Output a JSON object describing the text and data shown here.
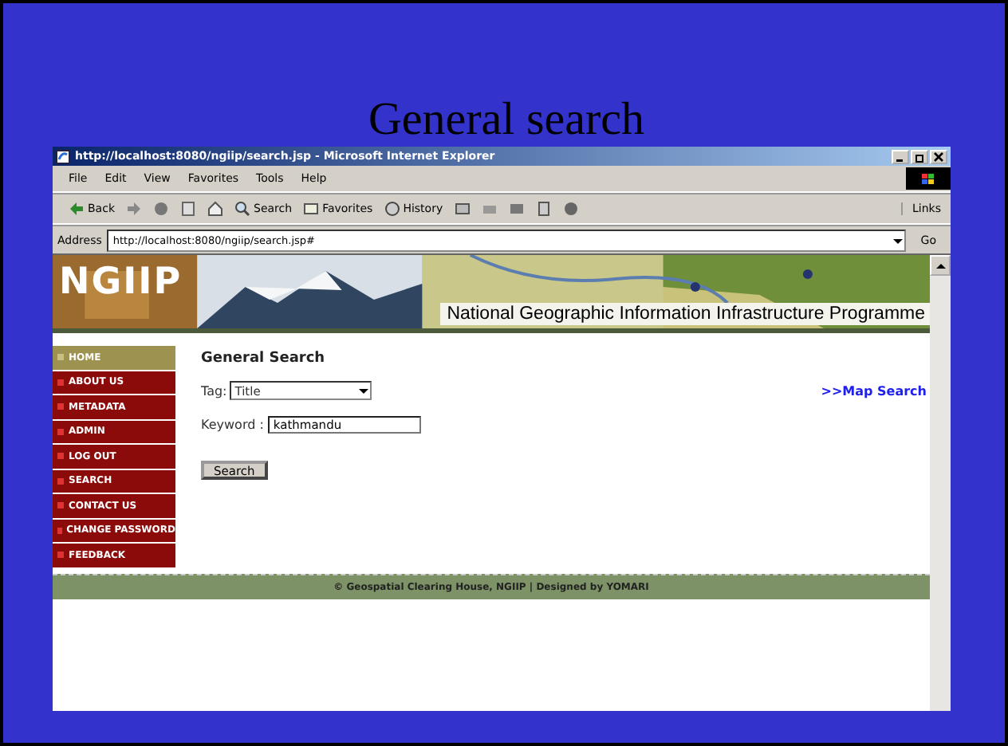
{
  "slide_title": "General search",
  "window": {
    "title": "http://localhost:8080/ngiip/search.jsp - Microsoft Internet Explorer"
  },
  "menu_bar": [
    "File",
    "Edit",
    "View",
    "Favorites",
    "Tools",
    "Help"
  ],
  "toolbar": [
    {
      "kind": "back",
      "label": "Back"
    },
    {
      "kind": "forward"
    },
    {
      "kind": "stop"
    },
    {
      "kind": "refresh"
    },
    {
      "kind": "home"
    },
    {
      "kind": "search",
      "label": "Search"
    },
    {
      "kind": "favorites",
      "label": "Favorites"
    },
    {
      "kind": "history",
      "label": "History"
    },
    {
      "kind": "mail"
    },
    {
      "kind": "print"
    },
    {
      "kind": "edit"
    },
    {
      "kind": "discuss"
    },
    {
      "kind": "messenger"
    }
  ],
  "links_label": "Links",
  "address": {
    "label": "Address",
    "value": "http://localhost:8080/ngiip/search.jsp#",
    "go": "Go"
  },
  "banner": {
    "logo": "NGIIP",
    "tagline": "National Geographic Information Infrastructure Programme"
  },
  "sidebar": {
    "items": [
      {
        "label": "HOME",
        "selected": true
      },
      {
        "label": "ABOUT US",
        "selected": false
      },
      {
        "label": "METADATA",
        "selected": false
      },
      {
        "label": "ADMIN",
        "selected": false
      },
      {
        "label": "LOG OUT",
        "selected": false
      },
      {
        "label": "SEARCH",
        "selected": false
      },
      {
        "label": "CONTACT US",
        "selected": false
      },
      {
        "label": "CHANGE PASSWORD",
        "selected": false
      },
      {
        "label": "FEEDBACK",
        "selected": false
      }
    ]
  },
  "form": {
    "heading": "General Search",
    "tag_label": "Tag:",
    "tag_value": "Title",
    "keyword_label": "Keyword :",
    "keyword_value": "kathmandu",
    "submit": "Search",
    "map_link": ">>Map Search"
  },
  "footer": "© Geospatial Clearing House, NGIIP | Designed by YOMARI"
}
